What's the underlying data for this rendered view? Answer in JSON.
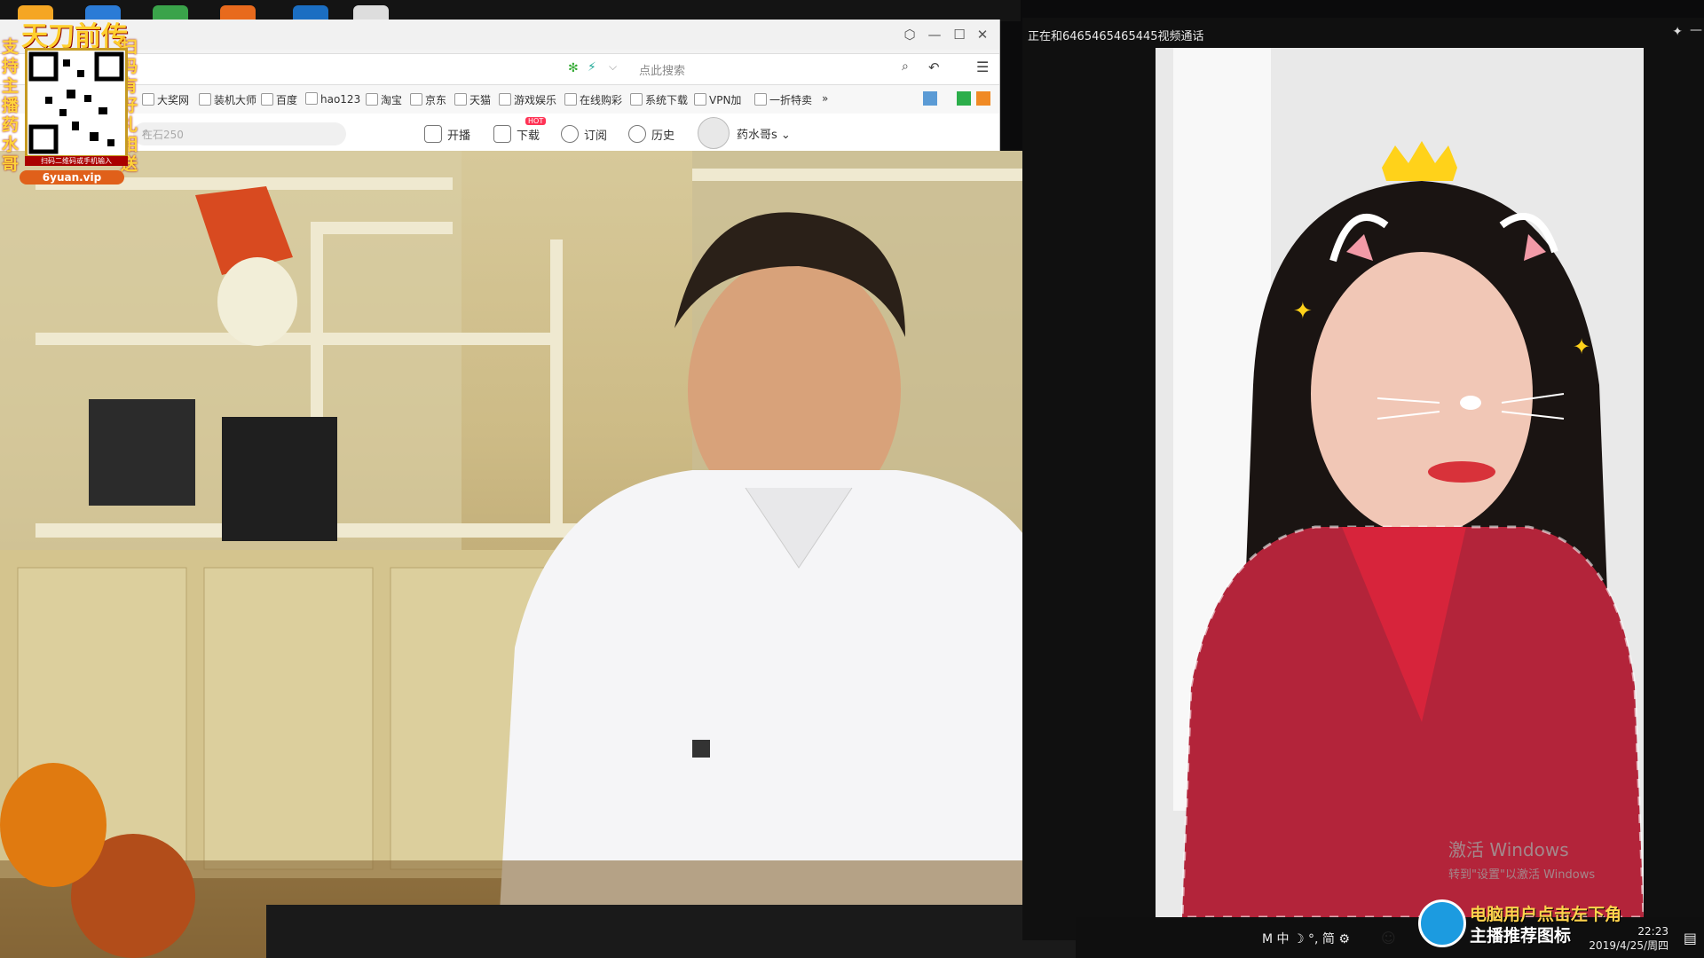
{
  "browser": {
    "search_placeholder": "点此搜索",
    "bookmarks": [
      "大奖网",
      "装机大师",
      "百度",
      "hao123",
      "淘宝",
      "京东",
      "天猫",
      "游戏娱乐",
      "在线购彩",
      "系统下载",
      "VPN加",
      "一折特卖"
    ],
    "bookmarks_more": "»",
    "site_search_placeholder": "在石250",
    "nav": {
      "live": "开播",
      "download": "下载",
      "hot_badge": "HOT",
      "subscribe": "订阅",
      "history": "历史",
      "user": "药水哥s"
    }
  },
  "call": {
    "title": "正在和6465465465445视频通话"
  },
  "ad": {
    "logo": "天刀前传",
    "left_vertical": "支持主播药水哥",
    "right_vertical": "扫码有好礼相送",
    "caption": "扫码二维码或手机输入",
    "site": "6yuan.vip"
  },
  "watermark": {
    "line1": "激活 Windows",
    "line2": "转到\"设置\"以激活 Windows"
  },
  "promo": {
    "line1": "电脑用户点击左下角",
    "line2": "主播推荐图标"
  },
  "tray": {
    "ime": "M 中 ☽ °, 简 ⚙",
    "time": "22:23",
    "date": "2019/4/25/周四"
  },
  "colors": {
    "accent_orange": "#e0601a",
    "promo_yellow": "#ffd34d",
    "tray_bg": "#0f0f0f"
  }
}
